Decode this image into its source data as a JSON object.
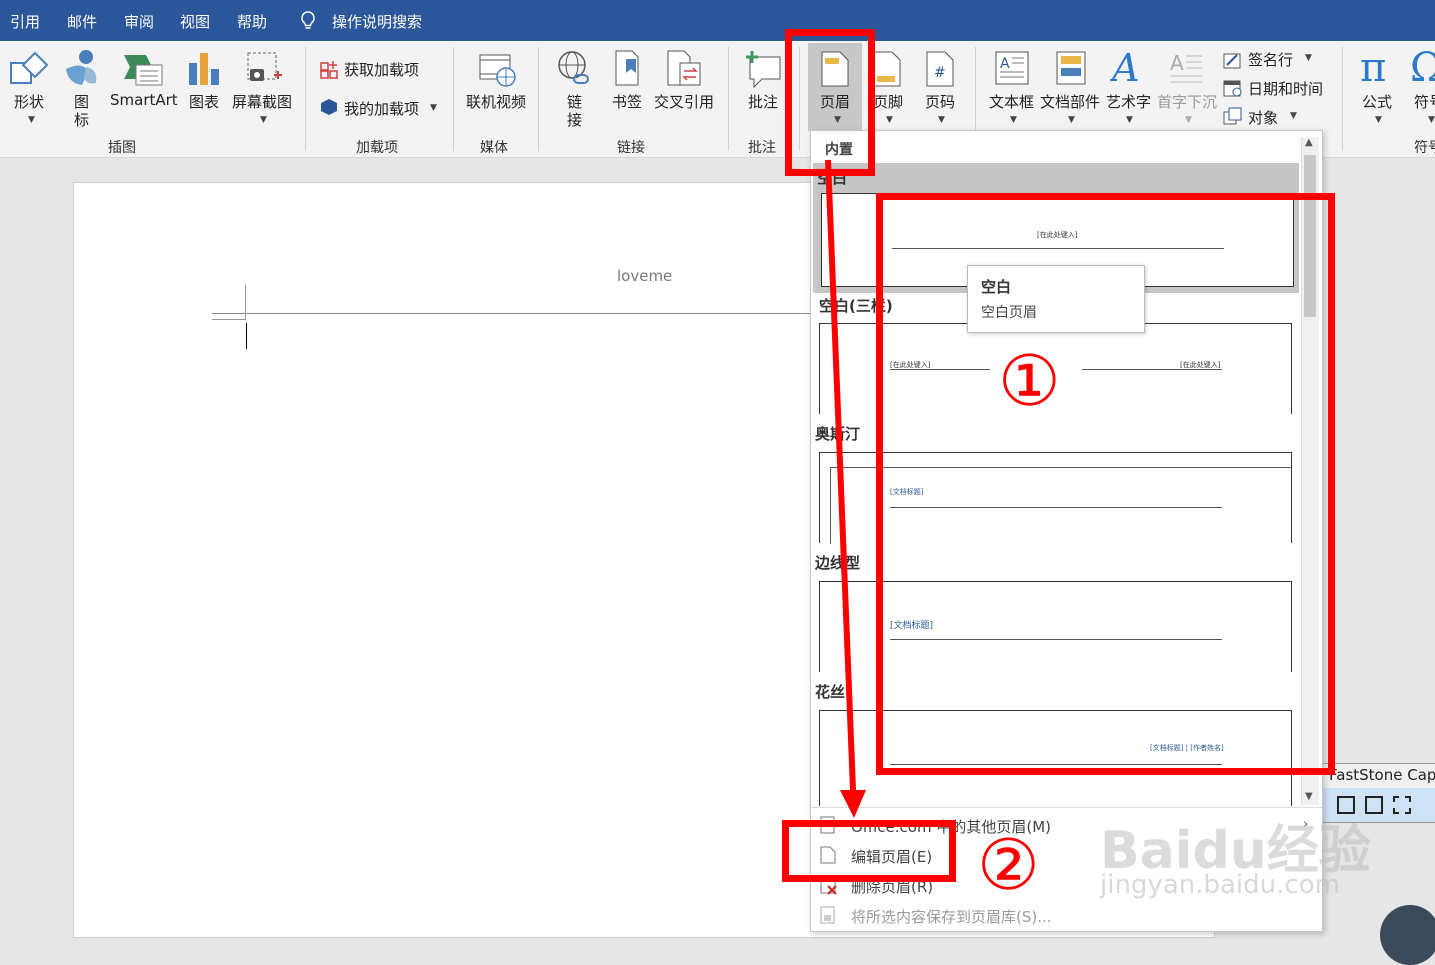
{
  "menubar": {
    "items": [
      "引用",
      "邮件",
      "审阅",
      "视图",
      "帮助"
    ],
    "search_label": "操作说明搜索"
  },
  "ribbon": {
    "buttons": {
      "shapes": "形状",
      "icons_1": "图",
      "icons_2": "标",
      "smartart": "SmartArt",
      "chart": "图表",
      "screenshot": "屏幕截图",
      "get_addins": "获取加载项",
      "my_addins": "我的加载项",
      "online_video": "联机视频",
      "link_1": "链",
      "link_2": "接",
      "bookmark": "书签",
      "cross_ref": "交叉引用",
      "comment": "批注",
      "header": "页眉",
      "footer": "页脚",
      "page_number": "页码",
      "textbox": "文本框",
      "quick_parts": "文档部件",
      "wordart": "艺术字",
      "drop_cap": "首字下沉",
      "signature": "签名行",
      "datetime": "日期和时间",
      "object": "对象",
      "equation": "公式",
      "symbol": "符号"
    },
    "groups": {
      "illustrations": "插图",
      "addins": "加载项",
      "media": "媒体",
      "links": "链接",
      "comments": "批注",
      "symbols": "符号"
    }
  },
  "document": {
    "header_text": "loveme"
  },
  "dropdown": {
    "builtin_label": "内置",
    "sections": [
      {
        "title": "空白",
        "placeholder": "[在此处键入]"
      },
      {
        "title": "空白(三栏)",
        "placeholder_left": "[在此处键入]",
        "placeholder_right": "[在此处键入]"
      },
      {
        "title": "奥斯汀",
        "placeholder": "[文档标题]"
      },
      {
        "title": "边线型",
        "placeholder": "[文档标题]"
      },
      {
        "title": "花丝",
        "placeholder": "[文档标题] | [作者姓名]"
      }
    ],
    "tooltip": {
      "title": "空白",
      "desc": "空白页眉"
    },
    "options": {
      "more": "Office.com 中的其他页眉(M)",
      "edit": "编辑页眉(E)",
      "remove": "删除页眉(R)",
      "save": "将所选内容保存到页眉库(S)..."
    }
  },
  "overlay": {
    "faststone": "FastStone Cap",
    "annotation_1": "①",
    "annotation_2": "②",
    "watermark_1": "Baidu经验",
    "watermark_2": "jingyan.baidu.com",
    "annotation_color": "#ff0000"
  },
  "colors": {
    "titlebar": "#2b579a",
    "ribbon": "#f3f3f3",
    "accent": "#2b579a"
  }
}
